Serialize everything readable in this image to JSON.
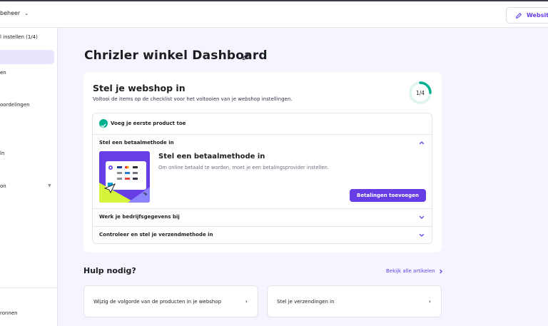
{
  "topbar": {
    "store_switch_label": "beheer",
    "website_button_label": "Website"
  },
  "sidebar": {
    "items": [
      {
        "label": "l instellen (1/4)"
      },
      {
        "label": "en"
      },
      {
        "label": ""
      },
      {
        "label": "oordelingen"
      },
      {
        "label": ""
      },
      {
        "label": "ln"
      },
      {
        "label": "on"
      },
      {
        "label": "ronnen"
      }
    ]
  },
  "main": {
    "page_title": "Chrizler winkel Dashboard",
    "setup_card": {
      "title": "Stel je webshop in",
      "subtitle": "Voltooi de items op de checklist voor het voltooien van je webshop instellingen.",
      "progress_label": "1/4",
      "progress_fraction": 0.25,
      "accent_color": "#00b090",
      "checklist": [
        {
          "label": "Voeg je eerste product toe",
          "done": true
        },
        {
          "label": "Stel een betaalmethode in",
          "expanded": true,
          "detail_title": "Stel een betaalmethode in",
          "detail_description": "Om online betaald te worden, moet je een betalingsprovider instellen.",
          "button_label": "Betalingen toevoegen"
        },
        {
          "label": "Werk je bedrijfsgegevens bij"
        },
        {
          "label": "Controleer en stel je verzendmethode in"
        }
      ]
    },
    "help": {
      "title": "Hulp nodig?",
      "view_all_label": "Bekijk alle artikelen",
      "cards": [
        {
          "label": "Wijzig de volgorde van de producten in je webshop"
        },
        {
          "label": "Stel je verzendingen in"
        }
      ]
    }
  },
  "colors": {
    "brand": "#673de6",
    "success": "#00b090",
    "background": "#f4f5ff"
  },
  "icons": {
    "website": "pencil-icon",
    "title_edit": "pencil-icon",
    "done": "check-circle-icon",
    "expand": "chevron-icon"
  }
}
